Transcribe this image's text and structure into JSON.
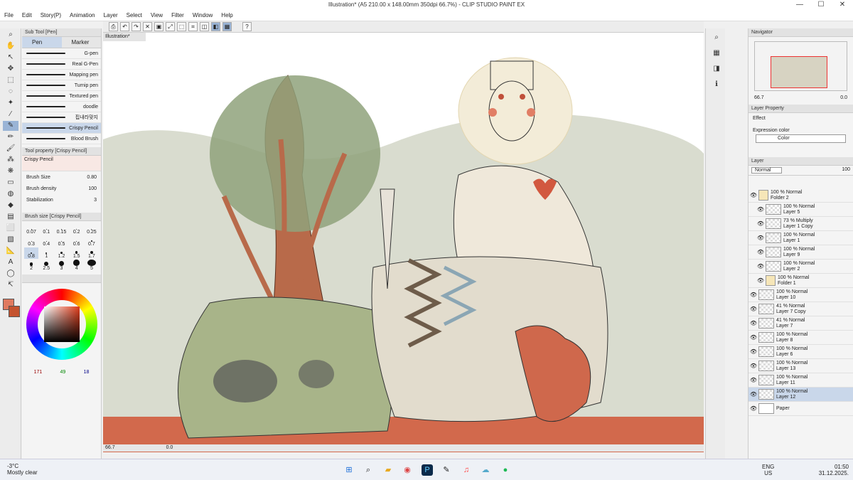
{
  "window": {
    "title": "Illustration* (A5 210.00 x 148.00mm 350dpi 66.7%) - CLIP STUDIO PAINT EX",
    "minimize": "—",
    "maximize": "☐",
    "close": "✕"
  },
  "menu": [
    "File",
    "Edit",
    "Story(P)",
    "Animation",
    "Layer",
    "Select",
    "View",
    "Filter",
    "Window",
    "Help"
  ],
  "subtool": {
    "header": "Sub Tool [Pen]",
    "tabs": [
      "Pen",
      "Marker"
    ],
    "brushes": [
      "G-pen",
      "Real G-Pen",
      "Mapping pen",
      "Turnip pen",
      "Textured pen",
      "doodle",
      "핍내라맞지",
      "Crispy Pencil",
      "Blood Brush"
    ],
    "selected": "Crispy Pencil"
  },
  "tool_property": {
    "header": "Tool property [Crispy Pencil]",
    "name": "Crispy Pencil",
    "brush_size_label": "Brush Size",
    "brush_size": "0.80",
    "density_label": "Brush density",
    "density": "100",
    "stabilization_label": "Stabilization",
    "stabilization": "3"
  },
  "brush_size_panel": {
    "header": "Brush size [Crispy Pencil]",
    "sizes": [
      "0.07",
      "0.1",
      "0.15",
      "0.2",
      "0.25",
      "0.3",
      "0.4",
      "0.5",
      "0.6",
      "0.7",
      "0.8",
      "1",
      "1.2",
      "1.5",
      "1.7",
      "2",
      "2.5",
      "3",
      "4",
      "5"
    ],
    "selected": "0.8"
  },
  "color": {
    "main": "#e07a5f",
    "sub": "#c4532f",
    "r": "171",
    "g": "49",
    "b": "18"
  },
  "document": {
    "tab": "Illustration*",
    "zoom": "66.7",
    "rotation": "0.0"
  },
  "navigator": {
    "header": "Navigator",
    "zoom": "66.7",
    "angle": "0.0"
  },
  "layer_property": {
    "header": "Layer Property",
    "effect_label": "Effect",
    "expression_label": "Expression color",
    "expression_value": "Color"
  },
  "layer_panel": {
    "header": "Layer",
    "blend": "Normal",
    "opacity": "100",
    "layers": [
      {
        "pct": "100 %",
        "mode": "Normal",
        "name": "Folder 2",
        "type": "folder",
        "indent": 0
      },
      {
        "pct": "100 %",
        "mode": "Normal",
        "name": "Layer 5",
        "type": "layer",
        "indent": 1
      },
      {
        "pct": "73 %",
        "mode": "Multiply",
        "name": "Layer 1 Copy",
        "type": "layer",
        "indent": 1
      },
      {
        "pct": "100 %",
        "mode": "Normal",
        "name": "Layer 1",
        "type": "layer",
        "indent": 1
      },
      {
        "pct": "100 %",
        "mode": "Normal",
        "name": "Layer 9",
        "type": "layer",
        "indent": 1
      },
      {
        "pct": "100 %",
        "mode": "Normal",
        "name": "Layer 2",
        "type": "layer",
        "indent": 1
      },
      {
        "pct": "100 %",
        "mode": "Normal",
        "name": "Folder 1",
        "type": "folder",
        "indent": 1
      },
      {
        "pct": "100 %",
        "mode": "Normal",
        "name": "Layer 10",
        "type": "layer",
        "indent": 0
      },
      {
        "pct": "41 %",
        "mode": "Normal",
        "name": "Layer 7 Copy",
        "type": "layer",
        "indent": 0
      },
      {
        "pct": "41 %",
        "mode": "Normal",
        "name": "Layer 7",
        "type": "layer",
        "indent": 0
      },
      {
        "pct": "100 %",
        "mode": "Normal",
        "name": "Layer 8",
        "type": "layer",
        "indent": 0
      },
      {
        "pct": "100 %",
        "mode": "Normal",
        "name": "Layer 6",
        "type": "layer",
        "indent": 0
      },
      {
        "pct": "100 %",
        "mode": "Normal",
        "name": "Layer 13",
        "type": "layer",
        "indent": 0
      },
      {
        "pct": "100 %",
        "mode": "Normal",
        "name": "Layer 11",
        "type": "layer",
        "indent": 0
      },
      {
        "pct": "100 %",
        "mode": "Normal",
        "name": "Layer 12",
        "type": "layer",
        "indent": 0,
        "selected": true
      },
      {
        "pct": "",
        "mode": "",
        "name": "Paper",
        "type": "paper",
        "indent": 0
      }
    ]
  },
  "taskbar": {
    "temp": "-3°C",
    "weather": "Mostly clear",
    "lang": "ENG",
    "region": "US",
    "time": "01:50",
    "date": "31.12.2025."
  }
}
